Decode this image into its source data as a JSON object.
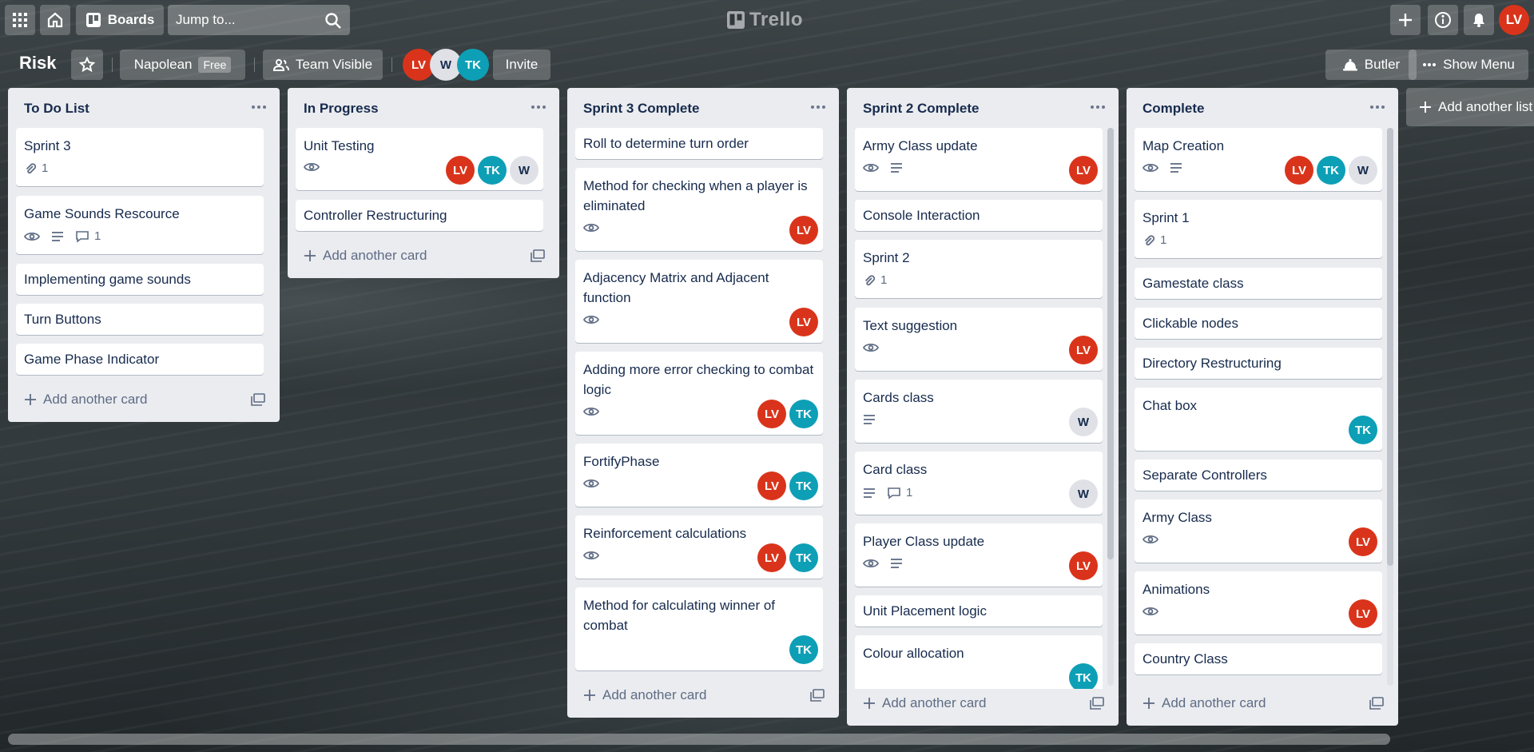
{
  "topbar": {
    "boards_label": "Boards",
    "jump_placeholder": "Jump to...",
    "logo_text": "Trello",
    "user_initials": "LV"
  },
  "board": {
    "title": "Risk",
    "team_name": "Napolean",
    "team_plan": "Free",
    "visibility": "Team Visible",
    "members": [
      "LV",
      "W",
      "TK"
    ],
    "invite_label": "Invite",
    "butler_label": "Butler",
    "show_menu_label": "Show Menu"
  },
  "lists": [
    {
      "title": "To Do List",
      "add_card_label": "Add another card",
      "cards": [
        {
          "title": "Sprint 3",
          "attachments": "1"
        },
        {
          "title": "Game Sounds Rescource",
          "comments": "1"
        },
        {
          "title": "Implementing game sounds"
        },
        {
          "title": "Turn Buttons"
        },
        {
          "title": "Game Phase Indicator"
        }
      ]
    },
    {
      "title": "In Progress",
      "add_card_label": "Add another card",
      "cards": [
        {
          "title": "Unit Testing",
          "members": [
            "LV",
            "TK",
            "W"
          ]
        },
        {
          "title": "Controller Restructuring"
        }
      ]
    },
    {
      "title": "Sprint 3 Complete",
      "add_card_label": "Add another card",
      "cards": [
        {
          "title": "Roll to determine turn order"
        },
        {
          "title": "Method for checking when a player is eliminated",
          "members": [
            "LV"
          ]
        },
        {
          "title": "Adjacency Matrix and Adjacent function",
          "members": [
            "LV"
          ]
        },
        {
          "title": "Adding more error checking to combat logic",
          "members": [
            "LV",
            "TK"
          ]
        },
        {
          "title": "FortifyPhase",
          "members": [
            "LV",
            "TK"
          ]
        },
        {
          "title": "Reinforcement calculations",
          "members": [
            "LV",
            "TK"
          ]
        },
        {
          "title": "Method for calculating winner of combat",
          "members": [
            "TK"
          ]
        }
      ]
    },
    {
      "title": "Sprint 2 Complete",
      "add_card_label": "Add another card",
      "cards": [
        {
          "title": "Army Class update",
          "members": [
            "LV"
          ]
        },
        {
          "title": "Console Interaction"
        },
        {
          "title": "Sprint 2",
          "attachments": "1"
        },
        {
          "title": "Text suggestion",
          "members": [
            "LV"
          ]
        },
        {
          "title": "Cards class",
          "members": [
            "W"
          ]
        },
        {
          "title": "Card class",
          "comments": "1",
          "members": [
            "W"
          ]
        },
        {
          "title": "Player Class update",
          "members": [
            "LV"
          ]
        },
        {
          "title": "Unit Placement logic"
        },
        {
          "title": "Colour allocation",
          "members": [
            "TK"
          ]
        }
      ]
    },
    {
      "title": "Complete",
      "add_card_label": "Add another card",
      "cards": [
        {
          "title": "Map Creation",
          "members": [
            "LV",
            "TK",
            "W"
          ]
        },
        {
          "title": "Sprint 1",
          "attachments": "1"
        },
        {
          "title": "Gamestate class"
        },
        {
          "title": "Clickable nodes"
        },
        {
          "title": "Directory Restructuring"
        },
        {
          "title": "Chat box",
          "members": [
            "TK"
          ]
        },
        {
          "title": "Separate Controllers"
        },
        {
          "title": "Army Class",
          "members": [
            "LV"
          ]
        },
        {
          "title": "Animations",
          "members": [
            "LV"
          ]
        },
        {
          "title": "Country Class"
        }
      ]
    }
  ],
  "add_list_label": "Add another list",
  "colors": {
    "lv": "#d9341b",
    "tk": "#0d9fb6",
    "w": "#dfe1e6",
    "list_bg": "#ebecf0"
  }
}
